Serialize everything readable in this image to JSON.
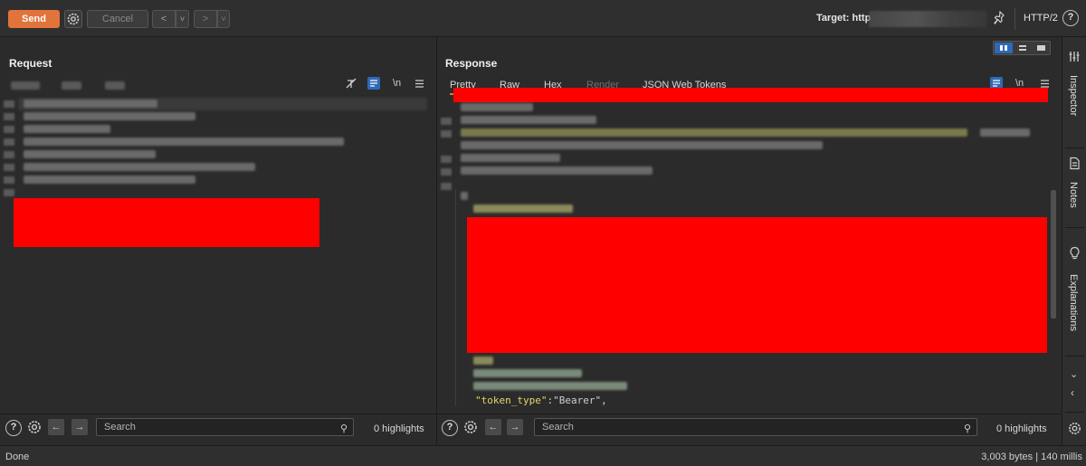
{
  "toolbar": {
    "send_label": "Send",
    "cancel_label": "Cancel",
    "back_label": "<",
    "forward_label": ">",
    "dropdown_label": "˅",
    "target_label": "Target: http",
    "protocol": "HTTP/2",
    "help_icon": "question-circle-icon"
  },
  "request": {
    "title": "Request",
    "bottom": {
      "search_placeholder": "Search",
      "highlights": "0 highlights"
    }
  },
  "response": {
    "title": "Response",
    "tabs": [
      "Pretty",
      "Raw",
      "Hex",
      "Render",
      "JSON Web Tokens"
    ],
    "active_tab": "Pretty",
    "disabled_tab": "Render",
    "visible_line": {
      "key": "\"token_type\"",
      "colon": ":",
      "value": "\"Bearer\"",
      "comma": ","
    },
    "newline_toggle": "\\n",
    "bottom": {
      "search_placeholder": "Search",
      "highlights": "0 highlights"
    }
  },
  "request_toggle": {
    "newline_toggle": "\\n"
  },
  "sidebar": {
    "items": [
      "Inspector",
      "Notes",
      "Explanations"
    ]
  },
  "status": {
    "left": "Done",
    "right": "3,003 bytes | 140 millis"
  },
  "colors": {
    "accent": "#e2733a",
    "background": "#2b2b2b",
    "redaction": "#ff0000",
    "json_key": "#e6d56a",
    "json_string": "#d0d0d0"
  },
  "icons": {
    "gear": "gear-icon",
    "search": "search-icon",
    "help": "question-circle-icon",
    "pin": "pin-icon"
  }
}
